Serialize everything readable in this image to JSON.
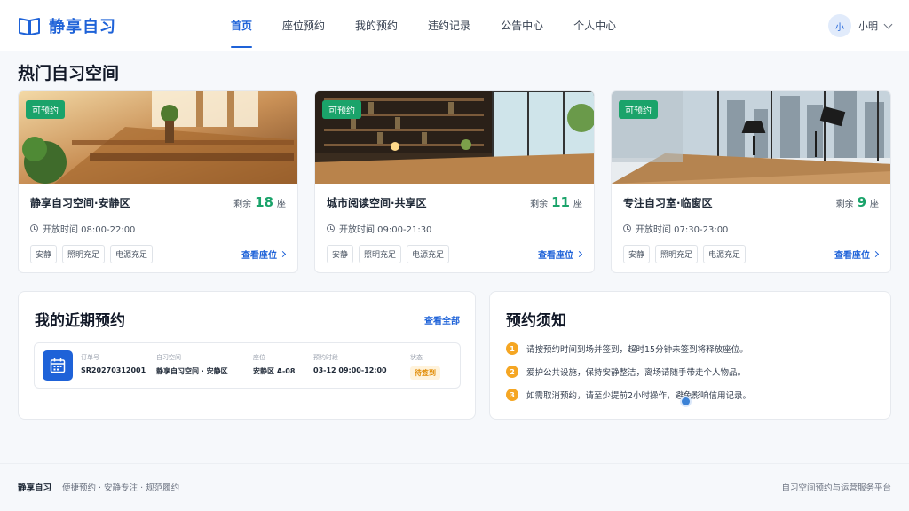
{
  "app": {
    "title": "静享自习"
  },
  "nav": {
    "items": [
      {
        "label": "首页",
        "active": true
      },
      {
        "label": "座位预约",
        "active": false
      },
      {
        "label": "我的预约",
        "active": false
      },
      {
        "label": "违约记录",
        "active": false
      },
      {
        "label": "公告中心",
        "active": false
      },
      {
        "label": "个人中心",
        "active": false
      }
    ]
  },
  "user": {
    "avatar_char": "小",
    "name": "小明"
  },
  "hot_section": {
    "title": "热门自习空间"
  },
  "spaces": [
    {
      "status": "可预约",
      "name": "静享自习空间·安静区",
      "remain_label": "剩余",
      "remain_count": "18",
      "remain_unit": "座",
      "hours": "开放时间 08:00-22:00",
      "tags": [
        "安静",
        "照明充足",
        "电源充足"
      ],
      "action": "查看座位"
    },
    {
      "status": "可预约",
      "name": "城市阅读空间·共享区",
      "remain_label": "剩余",
      "remain_count": "11",
      "remain_unit": "座",
      "hours": "开放时间 09:00-21:30",
      "tags": [
        "安静",
        "照明充足",
        "电源充足"
      ],
      "action": "查看座位"
    },
    {
      "status": "可预约",
      "name": "专注自习室·临窗区",
      "remain_label": "剩余",
      "remain_count": "9",
      "remain_unit": "座",
      "hours": "开放时间 07:30-23:00",
      "tags": [
        "安静",
        "照明充足",
        "电源充足"
      ],
      "action": "查看座位"
    }
  ],
  "recent": {
    "title": "我的近期预约",
    "view_all": "查看全部",
    "reservation": {
      "order_label": "订单号",
      "order_value": "SR20270312001",
      "space_label": "自习空间",
      "space_value": "静享自习空间 · 安静区",
      "seat_label": "座位",
      "seat_value": "安静区 A-08",
      "time_label": "预约时段",
      "time_value": "03-12 09:00-12:00",
      "status_label": "状态",
      "status_value": "待签到"
    }
  },
  "notice": {
    "title": "预约须知",
    "items": [
      {
        "num": "1",
        "text": "请按预约时间到场并签到，超时15分钟未签到将释放座位。"
      },
      {
        "num": "2",
        "text": "爱护公共设施，保持安静整洁，离场请随手带走个人物品。"
      },
      {
        "num": "3",
        "text": "如需取消预约，请至少提前2小时操作，避免影响信用记录。"
      }
    ]
  },
  "footer": {
    "brand": "静享自习",
    "slogan": "便捷预约 · 安静专注 · 规范履约",
    "right": "自习空间预约与运营服务平台"
  },
  "colors": {
    "primary": "#1e62d8",
    "success": "#1aa36a",
    "warning": "#f5a623"
  },
  "icons": {
    "logo": "book-icon",
    "clock": "clock-icon",
    "calendar": "calendar-icon",
    "chevron": "chevron-down-icon",
    "arrow": "chevron-right-icon"
  }
}
